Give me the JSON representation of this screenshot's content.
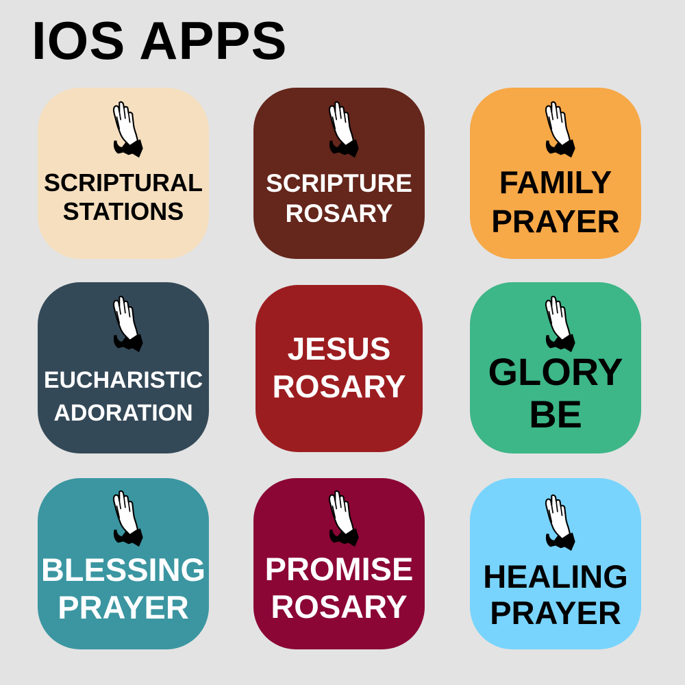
{
  "title": "IOS APPS",
  "apps": [
    {
      "line1": "SCRIPTURAL",
      "line2": "STATIONS",
      "bg": "#f5dfbf",
      "fg": "#000000",
      "icon": "praying-hands-icon"
    },
    {
      "line1": "SCRIPTURE",
      "line2": "ROSARY",
      "bg": "#65261c",
      "fg": "#ffffff",
      "icon": "praying-hands-icon"
    },
    {
      "line1": "FAMILY",
      "line2": "PRAYER",
      "bg": "#f7a847",
      "fg": "#000000",
      "icon": "praying-hands-icon"
    },
    {
      "line1": "EUCHARISTIC",
      "line2": "ADORATION",
      "bg": "#344958",
      "fg": "#ffffff",
      "icon": "praying-hands-icon"
    },
    {
      "line1": "JESUS",
      "line2": "ROSARY",
      "bg": "#9c1d20",
      "fg": "#ffffff",
      "icon": "none"
    },
    {
      "line1": "GLORY",
      "line2": "BE",
      "bg": "#3db688",
      "fg": "#000000",
      "icon": "praying-hands-icon"
    },
    {
      "line1": "BLESSING",
      "line2": "PRAYER",
      "bg": "#3b96a1",
      "fg": "#ffffff",
      "icon": "praying-hands-icon"
    },
    {
      "line1": "PROMISE",
      "line2": "ROSARY",
      "bg": "#8b0535",
      "fg": "#ffffff",
      "icon": "praying-hands-icon"
    },
    {
      "line1": "HEALING",
      "line2": "PRAYER",
      "bg": "#78d4fd",
      "fg": "#000000",
      "icon": "praying-hands-icon"
    }
  ]
}
